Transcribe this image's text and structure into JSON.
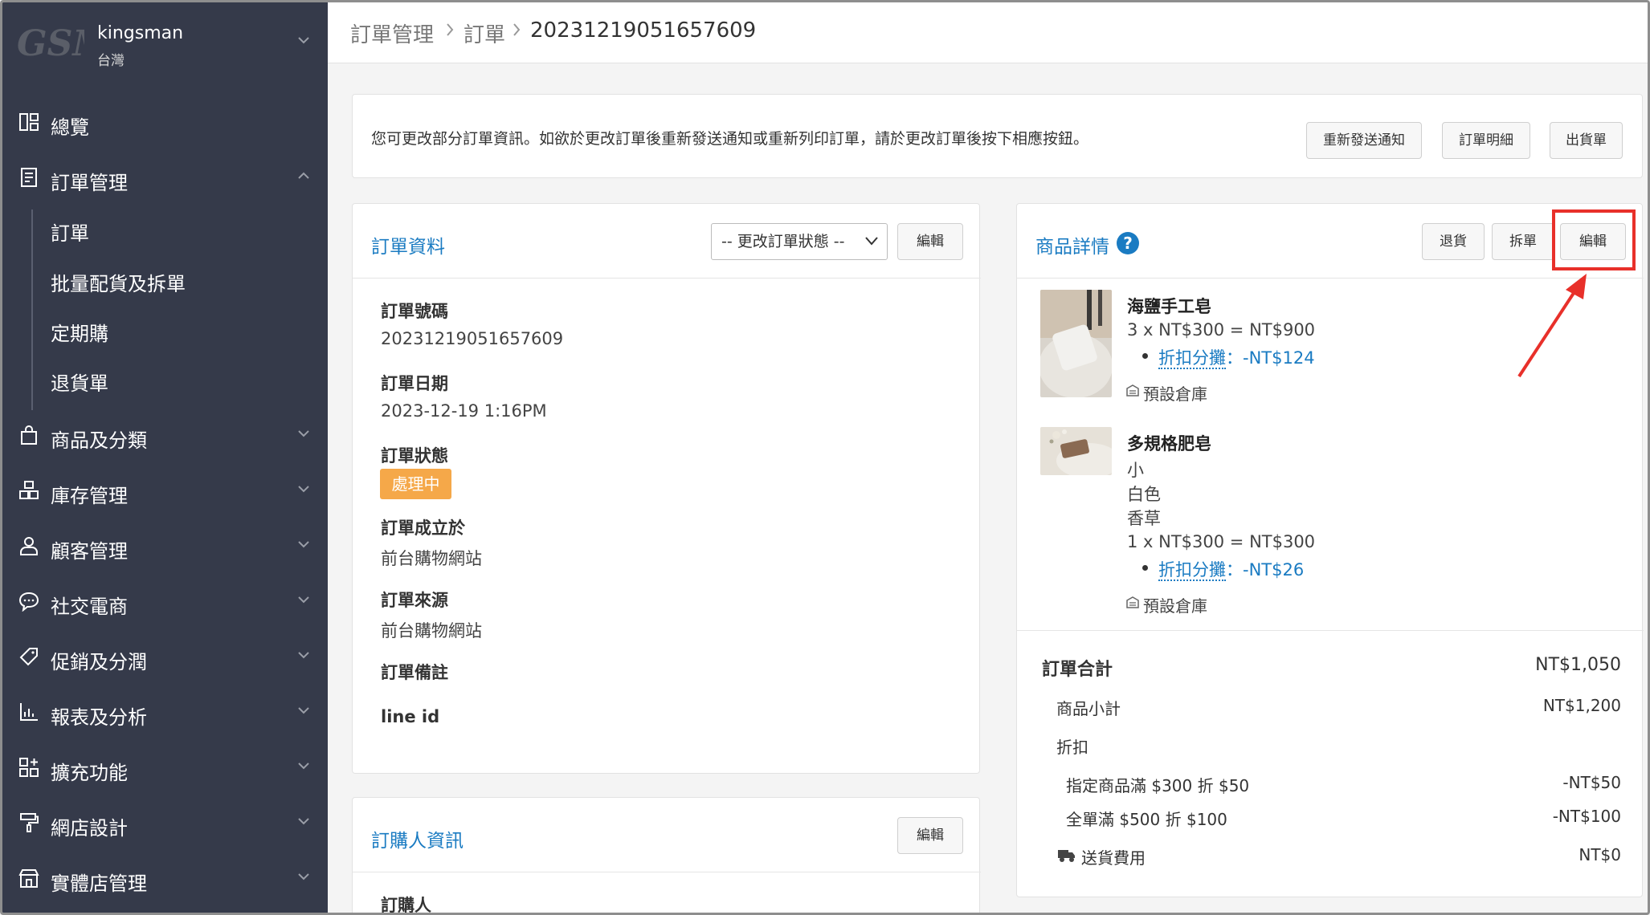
{
  "sidebar": {
    "logo": "GSM",
    "store_name": "kingsman",
    "store_region": "台灣",
    "items": [
      {
        "label": "總覽",
        "icon": "dashboard-icon"
      },
      {
        "label": "訂單管理",
        "icon": "order-list-icon",
        "expanded": true
      },
      {
        "label": "商品及分類",
        "icon": "shopping-bag-icon"
      },
      {
        "label": "庫存管理",
        "icon": "inventory-icon"
      },
      {
        "label": "顧客管理",
        "icon": "user-icon"
      },
      {
        "label": "社交電商",
        "icon": "chat-icon"
      },
      {
        "label": "促銷及分潤",
        "icon": "tag-icon"
      },
      {
        "label": "報表及分析",
        "icon": "chart-icon"
      },
      {
        "label": "擴充功能",
        "icon": "apps-icon"
      },
      {
        "label": "網店設計",
        "icon": "paint-roller-icon"
      },
      {
        "label": "實體店管理",
        "icon": "store-icon"
      }
    ],
    "sub_items": [
      "訂單",
      "批量配貨及拆單",
      "定期購",
      "退貨單"
    ]
  },
  "breadcrumb": [
    "訂單管理",
    "訂單",
    "20231219051657609"
  ],
  "notice": {
    "text": "您可更改部分訂單資訊。如欲於更改訂單後重新發送通知或重新列印訂單，請於更改訂單後按下相應按鈕。",
    "buttons": [
      "重新發送通知",
      "訂單明細",
      "出貨單"
    ]
  },
  "order_info": {
    "title": "訂單資料",
    "status_select": "-- 更改訂單狀態 --",
    "edit_label": "編輯",
    "fields": [
      {
        "label": "訂單號碼",
        "value": "20231219051657609"
      },
      {
        "label": "訂單日期",
        "value": "2023-12-19 1:16PM"
      },
      {
        "label": "訂單狀態",
        "value": "處理中"
      },
      {
        "label": "訂單成立於",
        "value": "前台購物網站"
      },
      {
        "label": "訂單來源",
        "value": "前台購物網站"
      },
      {
        "label": "訂單備註",
        "value": "line id"
      }
    ]
  },
  "buyer_info": {
    "title": "訂購人資訊",
    "edit_label": "編輯",
    "first_field": "訂購人"
  },
  "product_detail": {
    "title": "商品詳情",
    "help": "?",
    "buttons": [
      "退貨",
      "拆單",
      "編輯"
    ],
    "items": [
      {
        "name": "海鹽手工皂",
        "variants": [],
        "price_line": "3 x NT$300 = NT$900",
        "discount_label": "折扣分攤",
        "discount_value": "：-NT$124",
        "warehouse": "預設倉庫"
      },
      {
        "name": "多規格肥皂",
        "variants": [
          "小",
          "白色",
          "香草"
        ],
        "price_line": "1 x NT$300 = NT$300",
        "discount_label": "折扣分攤",
        "discount_value": "：-NT$26",
        "warehouse": "預設倉庫"
      }
    ]
  },
  "summary": {
    "total_label": "訂單合計",
    "total_value": "NT$1,050",
    "subtotal_label": "商品小計",
    "subtotal_value": "NT$1,200",
    "discount_label": "折扣",
    "discounts": [
      {
        "label": "指定商品滿 $300 折 $50",
        "value": "-NT$50"
      },
      {
        "label": "全單滿 $500 折 $100",
        "value": "-NT$100"
      }
    ],
    "shipping_label": "送貨費用",
    "shipping_value": "NT$0"
  },
  "colors": {
    "sidebar_bg": "#353a4a",
    "accent": "#1a7bc2",
    "status_badge": "#f5a849",
    "highlight": "#e8302a"
  }
}
